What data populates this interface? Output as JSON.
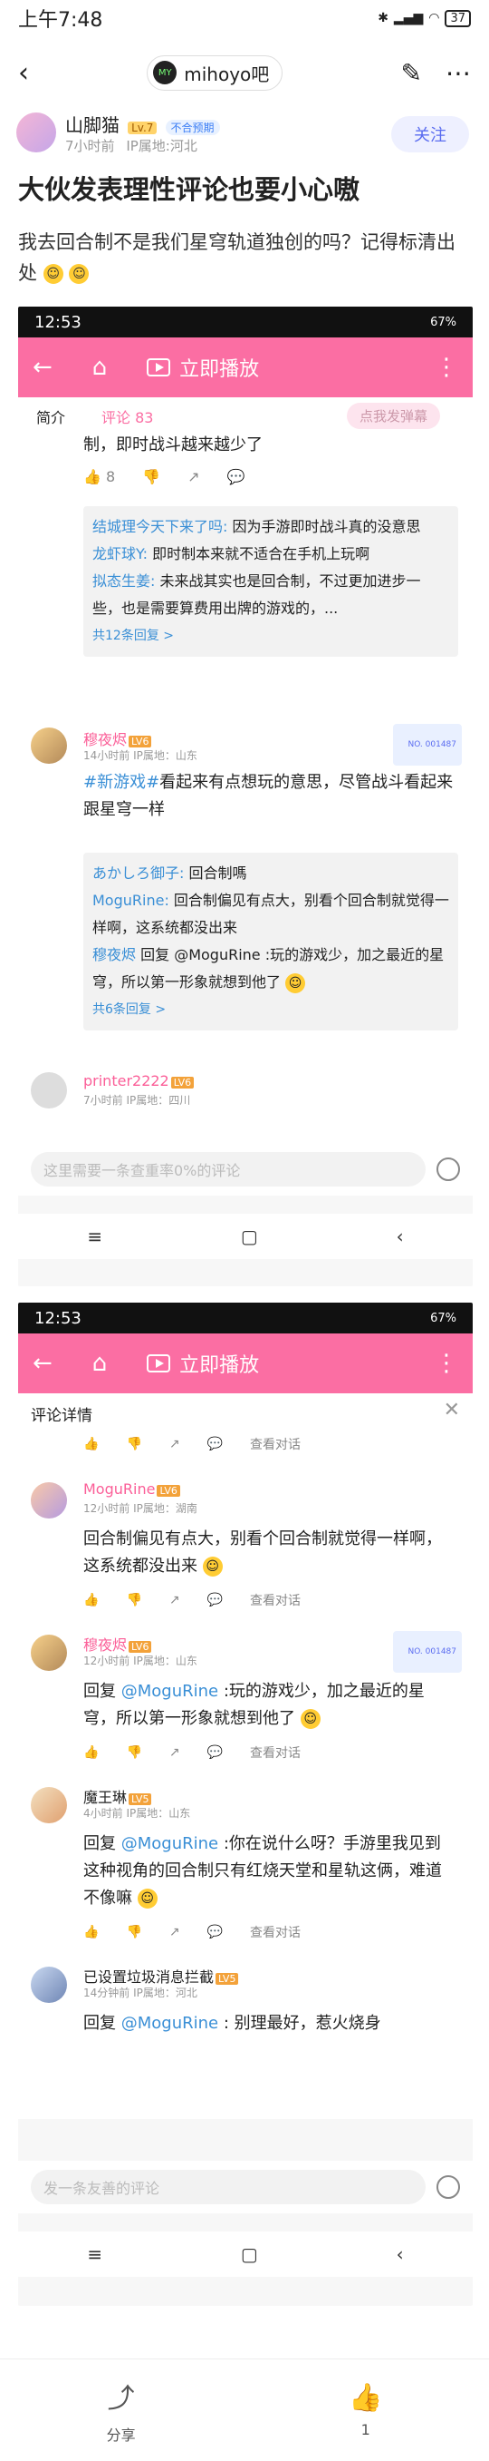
{
  "status": {
    "time": "上午7:48",
    "battery": "37"
  },
  "nav": {
    "forum": "mihoyo吧",
    "forum_logo": "MY"
  },
  "author": {
    "name": "山脚猫",
    "level": "Lv.7",
    "tag": "不合预期",
    "time": "7小时前",
    "ip": "IP属地:河北",
    "follow": "关注"
  },
  "post": {
    "title": "大伙发表理性评论也要小心嗷",
    "body": "我去回合制不是我们星穹轨道独创的吗？记得标清出处"
  },
  "shot1": {
    "time": "12:53",
    "battery": "67%",
    "play": "立即播放",
    "tabs": {
      "intro": "简介",
      "comments": "评论",
      "count": "83",
      "send": "点我发弹幕"
    },
    "top_text": "制，即时战斗越来越少了",
    "top_like": "8",
    "reply1": [
      {
        "name": "结城理今天下来了吗:",
        "text": "因为手游即时战斗真的没意思"
      },
      {
        "name": "龙虾球Y:",
        "text": "即时制本来就不适合在手机上玩啊"
      },
      {
        "name": "拟态生姜:",
        "text": "未来战其实也是回合制，不过更加进步一些，也是需要算费用出牌的游戏的，..."
      }
    ],
    "reply1_more": "共12条回复 >",
    "c2": {
      "name": "穆夜烬",
      "level": "LV6",
      "time": "14小时前",
      "ip": "IP属地：山东",
      "hashtag": "#新游戏#",
      "text": "看起来有点想玩的意思，尽管战斗看起来跟星穹一样",
      "badge": "NO.\n001487"
    },
    "reply2": [
      {
        "name": "あかしろ御子:",
        "text": "回合制嗎"
      },
      {
        "name": "MoguRine:",
        "text": "回合制偏见有点大，别看个回合制就觉得一样啊，这系统都没出来"
      },
      {
        "name": "穆夜烬",
        "text": "回复 @MoguRine :玩的游戏少，加之最近的星穹，所以第一形象就想到他了"
      }
    ],
    "reply2_more": "共6条回复 >",
    "c3": {
      "name": "printer2222",
      "level": "LV6",
      "time": "7小时前",
      "ip": "IP属地：四川"
    },
    "input": "这里需要一条查重率0%的评论"
  },
  "shot2": {
    "time": "12:53",
    "battery": "67%",
    "play": "立即播放",
    "header": "评论详情",
    "view": "查看对话",
    "comments": [
      {
        "name": "MoguRine",
        "level": "LV6",
        "time": "12小时前",
        "ip": "IP属地：湖南",
        "text": "回合制偏见有点大，别看个回合制就觉得一样啊，这系统都没出来"
      },
      {
        "name": "穆夜烬",
        "level": "LV6",
        "time": "12小时前",
        "ip": "IP属地：山东",
        "prefix": "回复 ",
        "at": "@MoguRine",
        "text": " :玩的游戏少，加之最近的星穹，所以第一形象就想到他了"
      },
      {
        "name": "魔王琳",
        "level": "LV5",
        "time": "4小时前",
        "ip": "IP属地：山东",
        "prefix": "回复 ",
        "at": "@MoguRine",
        "text": " :你在说什么呀？手游里我见到这种视角的回合制只有红烧天堂和星轨这俩，难道不像嘛"
      },
      {
        "name": "已设置垃圾消息拦截",
        "level": "LV5",
        "time": "14分钟前",
        "ip": "IP属地：河北",
        "prefix": "回复 ",
        "at": "@MoguRine",
        "text": " : 别理最好，惹火烧身"
      }
    ],
    "input": "发一条友善的评论"
  },
  "bottom": {
    "share": "分享",
    "like_count": "1"
  }
}
